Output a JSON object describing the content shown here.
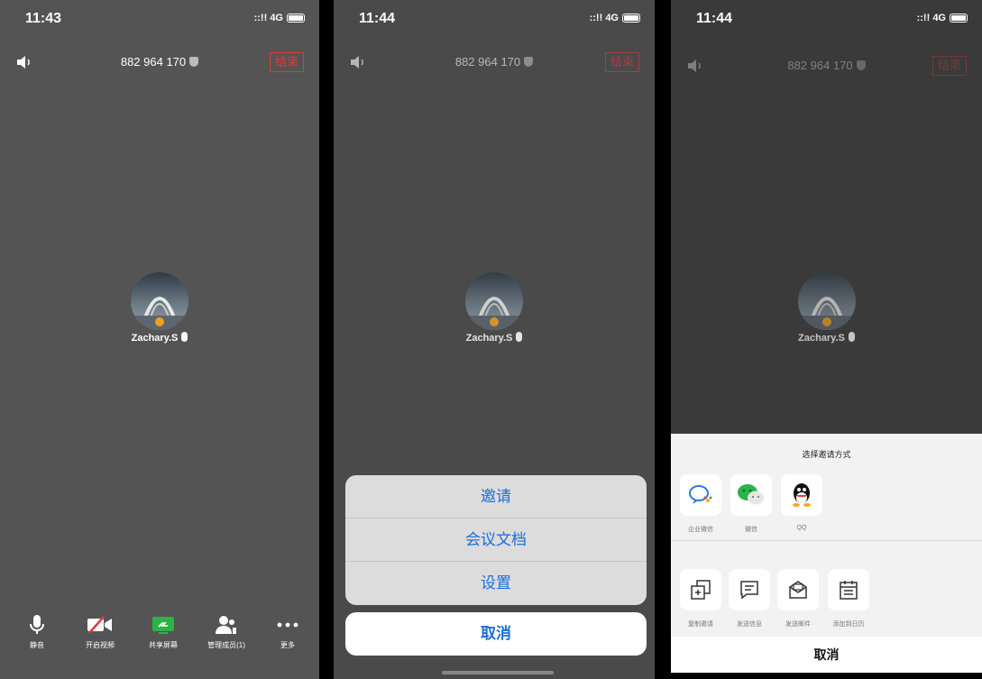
{
  "panels": [
    {
      "status": {
        "time": "11:43",
        "signal": "4G"
      },
      "meeting_id": "882 964 170",
      "end_label": "结束",
      "user_name": "Zachary.S",
      "toolbar": [
        {
          "label": "静音",
          "icon": "mic-icon"
        },
        {
          "label": "开启视频",
          "icon": "video-off-icon"
        },
        {
          "label": "共享屏幕",
          "icon": "share-screen-icon"
        },
        {
          "label": "管理成员(1)",
          "icon": "members-icon"
        },
        {
          "label": "更多",
          "icon": "more-icon"
        }
      ]
    },
    {
      "status": {
        "time": "11:44",
        "signal": "4G"
      },
      "meeting_id": "882 964 170",
      "end_label": "结束",
      "user_name": "Zachary.S",
      "action_sheet": {
        "items": [
          "邀请",
          "会议文档",
          "设置"
        ],
        "cancel": "取消"
      }
    },
    {
      "status": {
        "time": "11:44",
        "signal": "4G"
      },
      "meeting_id": "882 964 170",
      "end_label": "结束",
      "user_name": "Zachary.S",
      "invite_sheet": {
        "title": "选择邀请方式",
        "apps": [
          {
            "label": "企业微信",
            "icon": "wecom-icon"
          },
          {
            "label": "微信",
            "icon": "wechat-icon"
          },
          {
            "label": "QQ",
            "icon": "qq-icon"
          }
        ],
        "actions": [
          {
            "label": "复制邀请",
            "icon": "copy-icon"
          },
          {
            "label": "发送信息",
            "icon": "message-icon"
          },
          {
            "label": "发送邮件",
            "icon": "mail-icon"
          },
          {
            "label": "添加到日历",
            "icon": "calendar-icon"
          }
        ],
        "cancel": "取消"
      }
    }
  ],
  "colors": {
    "end": "#e03a3a",
    "link_blue": "#1a6fd6",
    "share_green": "#2bb34a"
  }
}
